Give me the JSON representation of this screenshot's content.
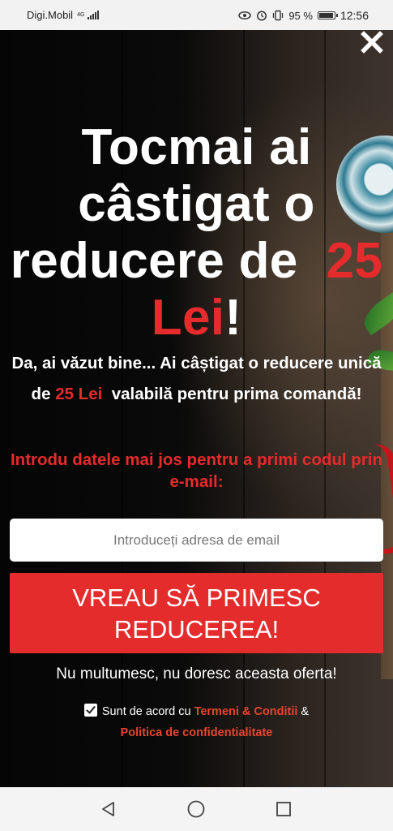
{
  "status_bar": {
    "carrier": "Digi.Mobil",
    "network_type": "4G",
    "battery_percent": "95 %",
    "time": "12:56"
  },
  "popup": {
    "headline": {
      "line1": "Tocmai ai",
      "line2": "câstigat o",
      "line3": "reducere de",
      "amount": "25",
      "currency": "Lei",
      "exclamation": "!"
    },
    "sub": {
      "part1": "Da, ai văzut bine... Ai câștigat o reducere unică de",
      "amount": "25 Lei",
      "part2": "valabilă pentru prima comandă!"
    },
    "instruction": "Introdu datele mai jos pentru a primi codul prin e-mail:",
    "email_placeholder": "Introduceți adresa de email",
    "cta_label": "VREAU SĂ PRIMESC REDUCEREA!",
    "decline_label": "Nu multumesc, nu doresc aceasta oferta!",
    "consent": {
      "checked": true,
      "prefix": "Sunt de acord cu",
      "terms": "Termeni & Conditii",
      "and": "&",
      "privacy": "Politica de confidentialitate"
    }
  },
  "colors": {
    "accent_red": "#e52b2b",
    "cta_red": "#e42c2c",
    "text_white": "#ffffff"
  },
  "icons": [
    "close-icon",
    "eye-icon",
    "alarm-icon",
    "vibrate-icon",
    "battery-icon",
    "signal-icon",
    "back-icon",
    "home-icon",
    "recents-icon"
  ]
}
